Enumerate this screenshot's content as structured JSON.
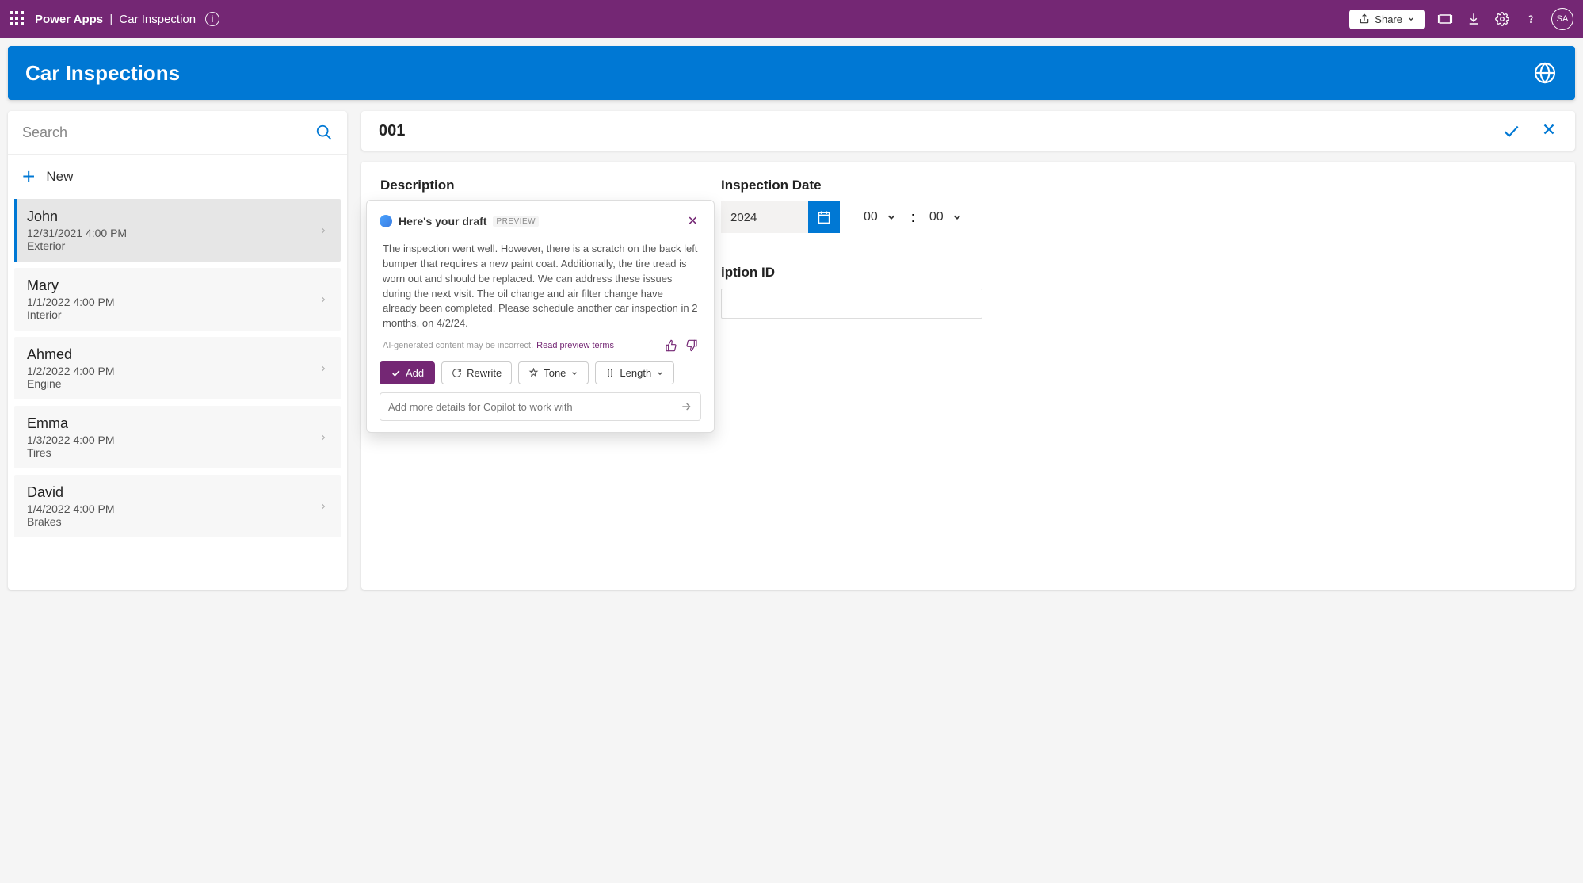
{
  "topbar": {
    "product": "Power Apps",
    "appName": "Car Inspection",
    "shareLabel": "Share",
    "avatarInitials": "SA"
  },
  "appHeader": {
    "title": "Car Inspections"
  },
  "leftPane": {
    "searchPlaceholder": "Search",
    "newLabel": "New",
    "items": [
      {
        "name": "John",
        "date": "12/31/2021 4:00 PM",
        "type": "Exterior",
        "selected": true
      },
      {
        "name": "Mary",
        "date": "1/1/2022 4:00 PM",
        "type": "Interior",
        "selected": false
      },
      {
        "name": "Ahmed",
        "date": "1/2/2022 4:00 PM",
        "type": "Engine",
        "selected": false
      },
      {
        "name": "Emma",
        "date": "1/3/2022 4:00 PM",
        "type": "Tires",
        "selected": false
      },
      {
        "name": "David",
        "date": "1/4/2022 4:00 PM",
        "type": "Brakes",
        "selected": false
      }
    ]
  },
  "detail": {
    "idLabel": "001",
    "descriptionLabel": "Description",
    "dateLabel": "Inspection Date",
    "dateValue": "2024",
    "hourValue": "00",
    "minuteValue": "00",
    "timeSep": ":",
    "idFieldLabel": "iption ID"
  },
  "copilot": {
    "title": "Here's your draft",
    "previewTag": "PREVIEW",
    "body": "The inspection went well. However, there is a scratch on the back left bumper that requires a new paint coat. Additionally, the tire tread is worn out and should be replaced. We can address these issues during the next visit. The oil change and air filter change have already been completed. Please schedule another car inspection in 2 months, on 4/2/24.",
    "disclaimer": "AI-generated content may be incorrect.",
    "disclaimerLink": "Read preview terms",
    "addLabel": "Add",
    "rewriteLabel": "Rewrite",
    "toneLabel": "Tone",
    "lengthLabel": "Length",
    "inputPlaceholder": "Add more details for Copilot to work with"
  }
}
